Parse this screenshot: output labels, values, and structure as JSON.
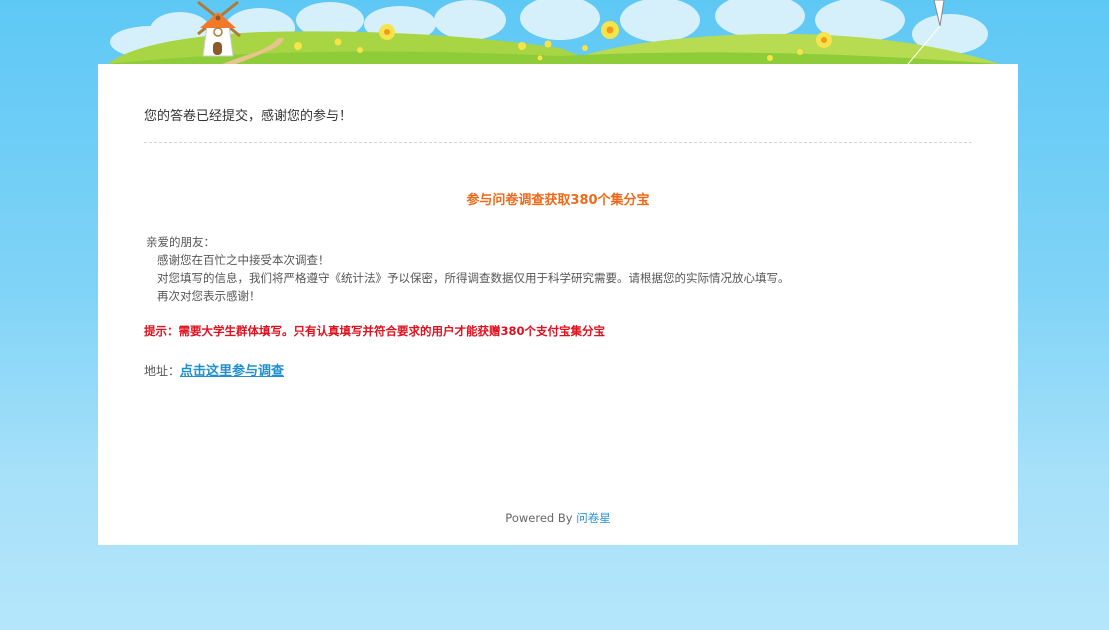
{
  "header": {
    "banner": "windmill-meadow-banner"
  },
  "main": {
    "submitted_message": "您的答卷已经提交，感谢您的参与！",
    "promo_title": "参与问卷调查获取380个集分宝",
    "letter": {
      "greeting": "亲爱的朋友：",
      "line1": "感谢您在百忙之中接受本次调查！",
      "line2": "对您填写的信息，我们将严格遵守《统计法》予以保密，所得调查数据仅用于科学研究需要。请根据您的实际情况放心填写。",
      "line3": "再次对您表示感谢！"
    },
    "tip": "提示：需要大学生群体填写。只有认真填写并符合要求的用户才能获赠380个支付宝集分宝",
    "address_label": "地址：",
    "address_link": "点击这里参与调查"
  },
  "footer": {
    "powered_by": "Powered By",
    "brand_link": "问卷星"
  },
  "colors": {
    "sky_top": "#5ec8f5",
    "sky_bottom": "#b5e6fb",
    "promo_orange": "#ee6a1a",
    "tip_red": "#e0101e",
    "link_blue": "#1f8fd0",
    "grass": "#8fcc3a"
  }
}
